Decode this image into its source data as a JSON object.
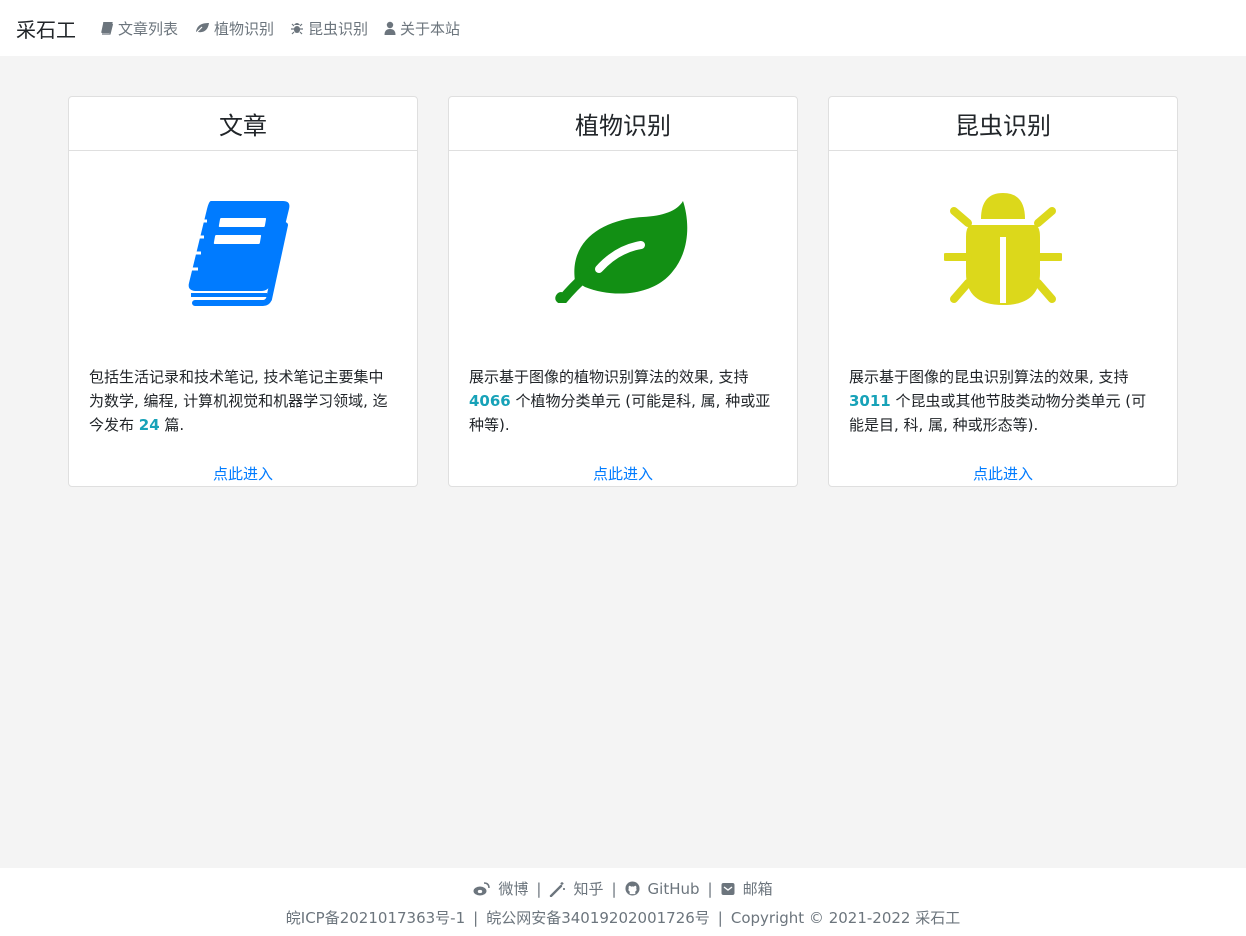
{
  "nav": {
    "brand": "采石工",
    "items": [
      {
        "label": "文章列表",
        "icon": "book-icon"
      },
      {
        "label": "植物识别",
        "icon": "leaf-icon"
      },
      {
        "label": "昆虫识别",
        "icon": "bug-icon"
      },
      {
        "label": "关于本站",
        "icon": "user-icon"
      }
    ]
  },
  "cards": [
    {
      "title": "文章",
      "icon": "book-icon",
      "icon_color": "#007bff",
      "text_before": "包括生活记录和技术笔记, 技术笔记主要集中为数学, 编程, 计算机视觉和机器学习领域, 迄今发布 ",
      "number": "24",
      "text_after": " 篇.",
      "link": "点此进入"
    },
    {
      "title": "植物识别",
      "icon": "leaf-icon",
      "icon_color": "#128f14",
      "text_before": "展示基于图像的植物识别算法的效果, 支持 ",
      "number": "4066",
      "text_after": " 个植物分类单元 (可能是科, 属, 种或亚种等).",
      "link": "点此进入"
    },
    {
      "title": "昆虫识别",
      "icon": "bug-icon",
      "icon_color": "#dcd81b",
      "text_before": "展示基于图像的昆虫识别算法的效果, 支持 ",
      "number": "3011",
      "text_after": " 个昆虫或其他节肢类动物分类单元 (可能是目, 科, 属, 种或形态等).",
      "link": "点此进入"
    }
  ],
  "footer": {
    "links": [
      {
        "label": "微博",
        "icon": "weibo-icon"
      },
      {
        "label": "知乎",
        "icon": "magic-wand-icon"
      },
      {
        "label": "GitHub",
        "icon": "github-icon"
      },
      {
        "label": "邮箱",
        "icon": "mail-icon"
      }
    ],
    "separator": "|",
    "icp": "皖ICP备2021017363号-1",
    "police": "皖公网安备34019202001726号",
    "copyright": "Copyright © 2021-2022 采石工"
  }
}
